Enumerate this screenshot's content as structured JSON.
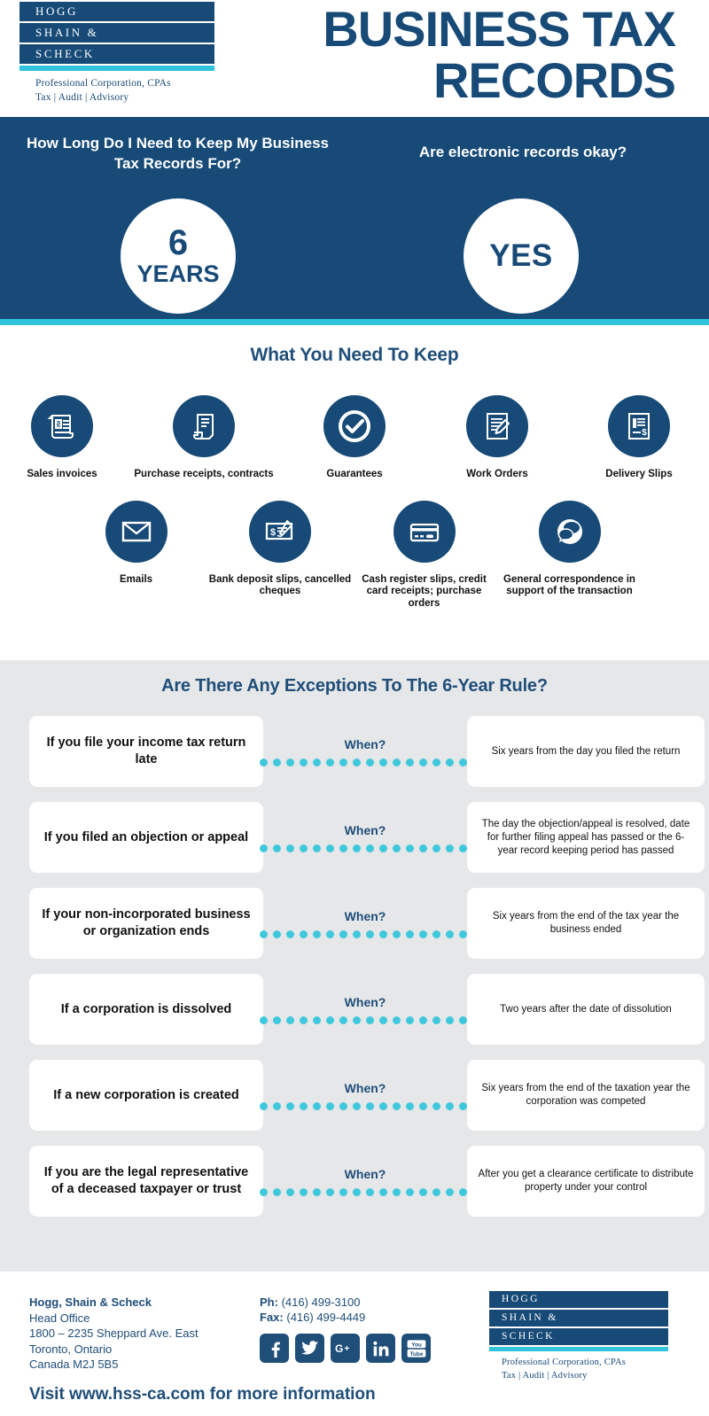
{
  "brand": {
    "logo_lines": [
      "HOGG",
      "SHAIN &",
      "SCHECK"
    ],
    "tagline_1": "Professional Corporation, CPAs",
    "tagline_2": "Tax | Audit | Advisory",
    "colors": {
      "primary_blue": "#174A77",
      "accent_cyan": "#2FC3DC",
      "gray_section": "#E6E7E9",
      "heading_blue": "#1F4E79"
    }
  },
  "header": {
    "title_line_1": "BUSINESS TAX",
    "title_line_2": "RECORDS"
  },
  "hero": {
    "question_left": "How Long Do I Need to Keep My Business Tax Records For?",
    "question_right": "Are electronic records okay?",
    "answer_left_big": "6",
    "answer_left_sub": "YEARS",
    "answer_right": "YES"
  },
  "keep": {
    "title": "What You Need To Keep",
    "row1": [
      {
        "icon": "invoice-icon",
        "label": "Sales invoices"
      },
      {
        "icon": "receipt-icon",
        "label": "Purchase receipts, contracts"
      },
      {
        "icon": "check-circle-icon",
        "label": "Guarantees"
      },
      {
        "icon": "document-pencil-icon",
        "label": "Work Orders"
      },
      {
        "icon": "delivery-slip-icon",
        "label": "Delivery Slips"
      }
    ],
    "row2": [
      {
        "icon": "envelope-icon",
        "label": "Emails"
      },
      {
        "icon": "cheque-icon",
        "label": "Bank deposit slips, cancelled cheques"
      },
      {
        "icon": "credit-card-icon",
        "label": "Cash register slips, credit card receipts; purchase orders"
      },
      {
        "icon": "speech-bubbles-icon",
        "label": "General correspondence in support of the transaction"
      }
    ]
  },
  "exceptions": {
    "title": "Are There Any Exceptions To The 6-Year Rule?",
    "when_label": "When?",
    "dot_count": 16,
    "rows": [
      {
        "condition": "If you file your income tax return late",
        "answer": "Six years from the day you filed the return"
      },
      {
        "condition": "If you filed an objection or appeal",
        "answer": "The day the objection/appeal is resolved, date for further filing appeal has passed or the 6-year record keeping period has passed"
      },
      {
        "condition": "If your non-incorporated business or organization ends",
        "answer": "Six years from the end of the tax year the business ended"
      },
      {
        "condition": "If a corporation is dissolved",
        "answer": "Two years after the date of dissolution"
      },
      {
        "condition": "If a new corporation is created",
        "answer": "Six years from the end of the taxation year the corporation was competed"
      },
      {
        "condition": "If you are the legal representative of a deceased taxpayer or trust",
        "answer": "After you get a clearance certificate to distribute property under your control"
      }
    ]
  },
  "footer": {
    "company": "Hogg, Shain & Scheck",
    "office": "Head Office",
    "street": "1800 – 2235 Sheppard Ave. East",
    "city": "Toronto, Ontario",
    "postal": "Canada M2J 5B5",
    "phone_label": "Ph:",
    "phone": "(416) 499-3100",
    "fax_label": "Fax:",
    "fax": "(416) 499-4449",
    "social": [
      "facebook-icon",
      "twitter-icon",
      "google-plus-icon",
      "linkedin-icon",
      "youtube-icon"
    ],
    "visit": "Visit www.hss-ca.com for more information"
  }
}
